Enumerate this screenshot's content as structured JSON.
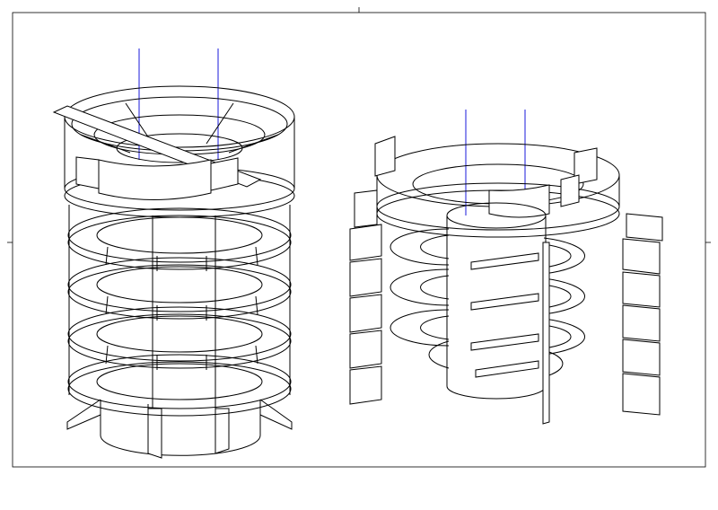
{
  "drawing": {
    "type": "isometric-line-drawing",
    "views": [
      {
        "name": "assembled-cylindrical-structure",
        "floor_levels": 4,
        "has_top_ring": true,
        "has_central_shaft": true
      },
      {
        "name": "exploded-cylindrical-structure",
        "floor_levels": 4,
        "side_panel_columns": 2,
        "has_top_ring": true,
        "has_central_shaft": true
      }
    ],
    "colors": {
      "line": "#000000",
      "axis": "#1a1adb",
      "background": "#ffffff"
    }
  }
}
